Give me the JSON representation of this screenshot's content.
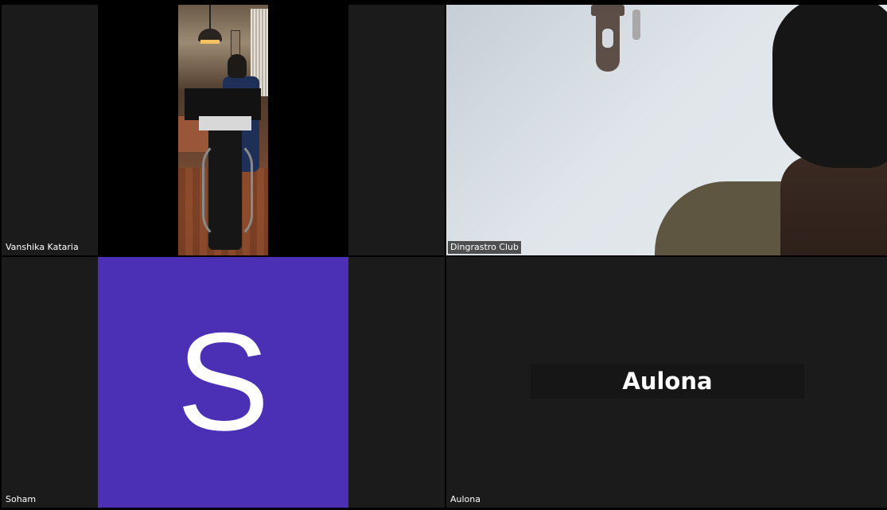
{
  "participants": [
    {
      "name": "Vanshika Kataria",
      "video": true
    },
    {
      "name": "Dingrastro Club",
      "video": true
    },
    {
      "name": "Soham",
      "video": false,
      "avatar_letter": "S",
      "avatar_color": "#4b2fb5"
    },
    {
      "name": "Aulona",
      "video": false,
      "display_name": "Aulona"
    }
  ],
  "colors": {
    "tile_background": "#1b1b1b",
    "frame_background": "#000000",
    "avatar_color": "#4b2fb5"
  }
}
